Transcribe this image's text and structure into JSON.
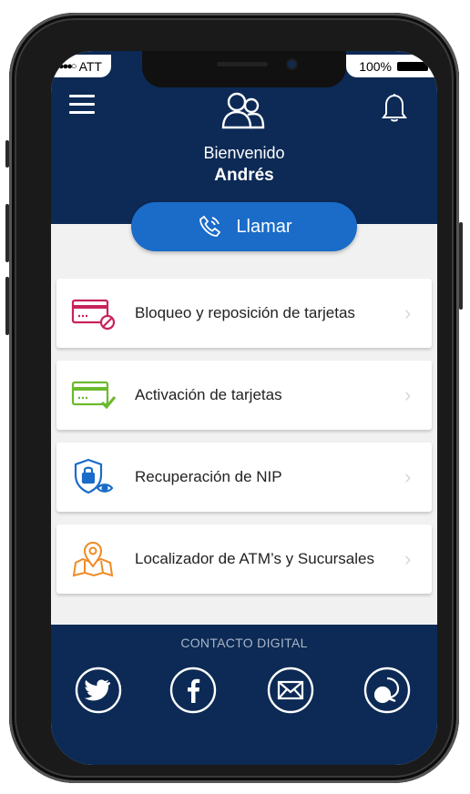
{
  "status_bar": {
    "carrier": "ATT",
    "battery": "100%"
  },
  "header": {
    "welcome": "Bienvenido",
    "user_name": "Andrés"
  },
  "call_button": {
    "label": "Llamar"
  },
  "menu_items": [
    {
      "label": "Bloqueo y reposición de tarjetas",
      "icon": "card-block-icon",
      "color": "#c8235b"
    },
    {
      "label": "Activación de tarjetas",
      "icon": "card-check-icon",
      "color": "#6cba2e"
    },
    {
      "label": "Recuperación de NIP",
      "icon": "lock-shield-icon",
      "color": "#1a6cc8"
    },
    {
      "label": "Localizador de ATM’s y Sucursales",
      "icon": "map-pin-icon",
      "color": "#f08a24"
    }
  ],
  "footer": {
    "title": "CONTACTO DIGITAL",
    "social": [
      "twitter-icon",
      "facebook-icon",
      "mail-icon",
      "chat-icon"
    ]
  },
  "colors": {
    "primary_dark": "#0c2a55",
    "accent_blue": "#1a6cc8",
    "background": "#f1f1f1"
  }
}
